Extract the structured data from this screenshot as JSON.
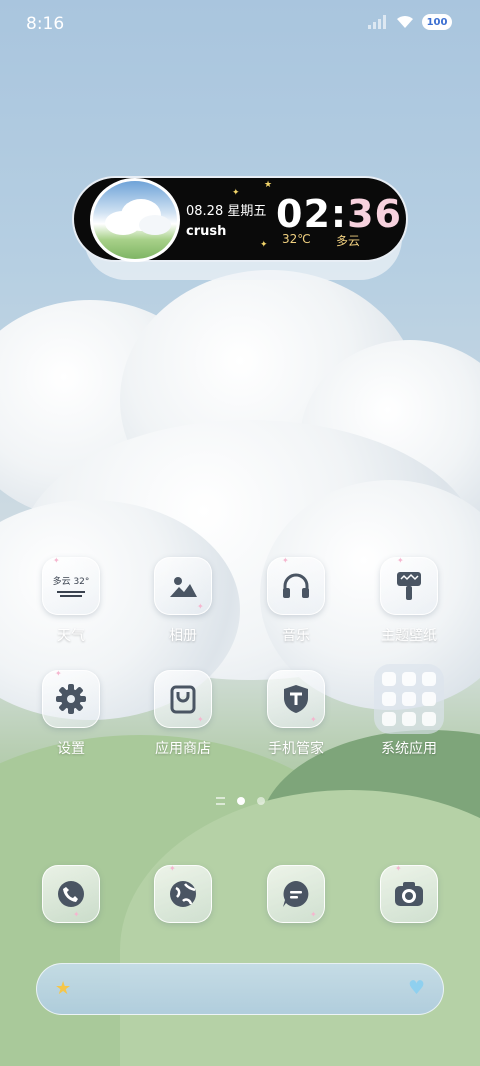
{
  "status_bar": {
    "time": "8:16",
    "battery": "100"
  },
  "widget": {
    "date": "08.28 星期五",
    "caption": "crush",
    "clock_hours": "02",
    "clock_minutes": "36",
    "temperature": "32℃",
    "weather": "多云"
  },
  "apps_row1": [
    {
      "label": "天气",
      "icon": "weather-icon",
      "icon_text": "多云 32°"
    },
    {
      "label": "相册",
      "icon": "gallery-icon"
    },
    {
      "label": "音乐",
      "icon": "headphones-icon"
    },
    {
      "label": "主题壁纸",
      "icon": "theme-paintbrush-icon"
    }
  ],
  "apps_row2": [
    {
      "label": "设置",
      "icon": "gear-icon"
    },
    {
      "label": "应用商店",
      "icon": "shopping-bag-icon"
    },
    {
      "label": "手机管家",
      "icon": "shield-icon"
    },
    {
      "label": "系统应用",
      "icon": "folder-icon"
    }
  ],
  "dock": [
    {
      "icon": "phone-icon"
    },
    {
      "icon": "browser-globe-icon"
    },
    {
      "icon": "messages-icon"
    },
    {
      "icon": "camera-icon"
    }
  ],
  "pages": {
    "count": 2,
    "active": 0
  },
  "colors": {
    "widget_bg": "#0a0a0a",
    "clock_minutes": "#f7d2de",
    "widget_accent": "#f0d080",
    "icon_glyph": "#4a5563"
  }
}
